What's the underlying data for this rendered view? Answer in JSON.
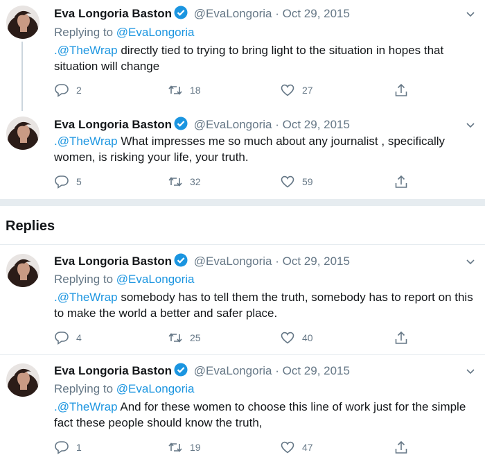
{
  "section": {
    "replies_heading": "Replies"
  },
  "colors": {
    "accent": "#1b95e0",
    "muted": "#657786",
    "text": "#14171a",
    "divider": "#e6ecf0"
  },
  "tweets": [
    {
      "name": "Eva Longoria Baston",
      "handle": "@EvaLongoria",
      "sep": "·",
      "date": "Oct 29, 2015",
      "replying_prefix": "Replying to ",
      "replying_to": "@EvaLongoria",
      "mention": ".@TheWrap",
      "body": " directly tied to trying to bring light to the situation in hopes that situation will change",
      "replies": "2",
      "retweets": "18",
      "likes": "27"
    },
    {
      "name": "Eva Longoria Baston",
      "handle": "@EvaLongoria",
      "sep": "·",
      "date": "Oct 29, 2015",
      "mention": ".@TheWrap",
      "body": " What impresses me so much about any journalist , specifically women, is risking your life, your truth.",
      "replies": "5",
      "retweets": "32",
      "likes": "59"
    },
    {
      "name": "Eva Longoria Baston",
      "handle": "@EvaLongoria",
      "sep": "·",
      "date": "Oct 29, 2015",
      "replying_prefix": "Replying to ",
      "replying_to": "@EvaLongoria",
      "mention": ".@TheWrap",
      "body": " somebody has to tell them the truth, somebody has to report on this to make the world a better and safer place.",
      "replies": "4",
      "retweets": "25",
      "likes": "40"
    },
    {
      "name": "Eva Longoria Baston",
      "handle": "@EvaLongoria",
      "sep": "·",
      "date": "Oct 29, 2015",
      "replying_prefix": "Replying to ",
      "replying_to": "@EvaLongoria",
      "mention": ".@TheWrap",
      "body": " And for these women to choose this line of work just for the simple fact these people should know the truth,",
      "replies": "1",
      "retweets": "19",
      "likes": "47"
    }
  ]
}
